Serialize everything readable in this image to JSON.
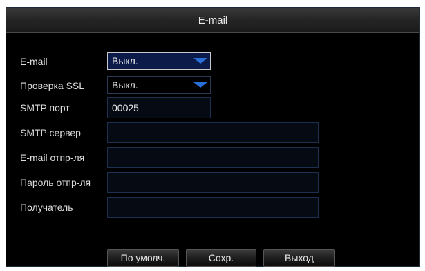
{
  "dialog": {
    "title": "E-mail"
  },
  "form": {
    "email": {
      "label": "E-mail",
      "value": "Выкл."
    },
    "ssl": {
      "label": "Проверка SSL",
      "value": "Выкл."
    },
    "smtp_port": {
      "label": "SMTP порт",
      "value": "00025"
    },
    "smtp_server": {
      "label": "SMTP сервер",
      "value": ""
    },
    "sender_email": {
      "label": "E-mail отпр-ля",
      "value": ""
    },
    "sender_password": {
      "label": "Пароль отпр-ля",
      "value": ""
    },
    "recipient": {
      "label": "Получатель",
      "value": ""
    }
  },
  "buttons": {
    "default_label": "По умолч.",
    "save_label": "Сохр.",
    "exit_label": "Выход"
  },
  "colors": {
    "dialog_background": "#000000",
    "focused_select_background": "#0c1a4a",
    "dropdown_arrow": "#2a6fd8",
    "text": "#e8e8e8"
  },
  "icons": {
    "dropdown": "chevron-down-icon"
  }
}
